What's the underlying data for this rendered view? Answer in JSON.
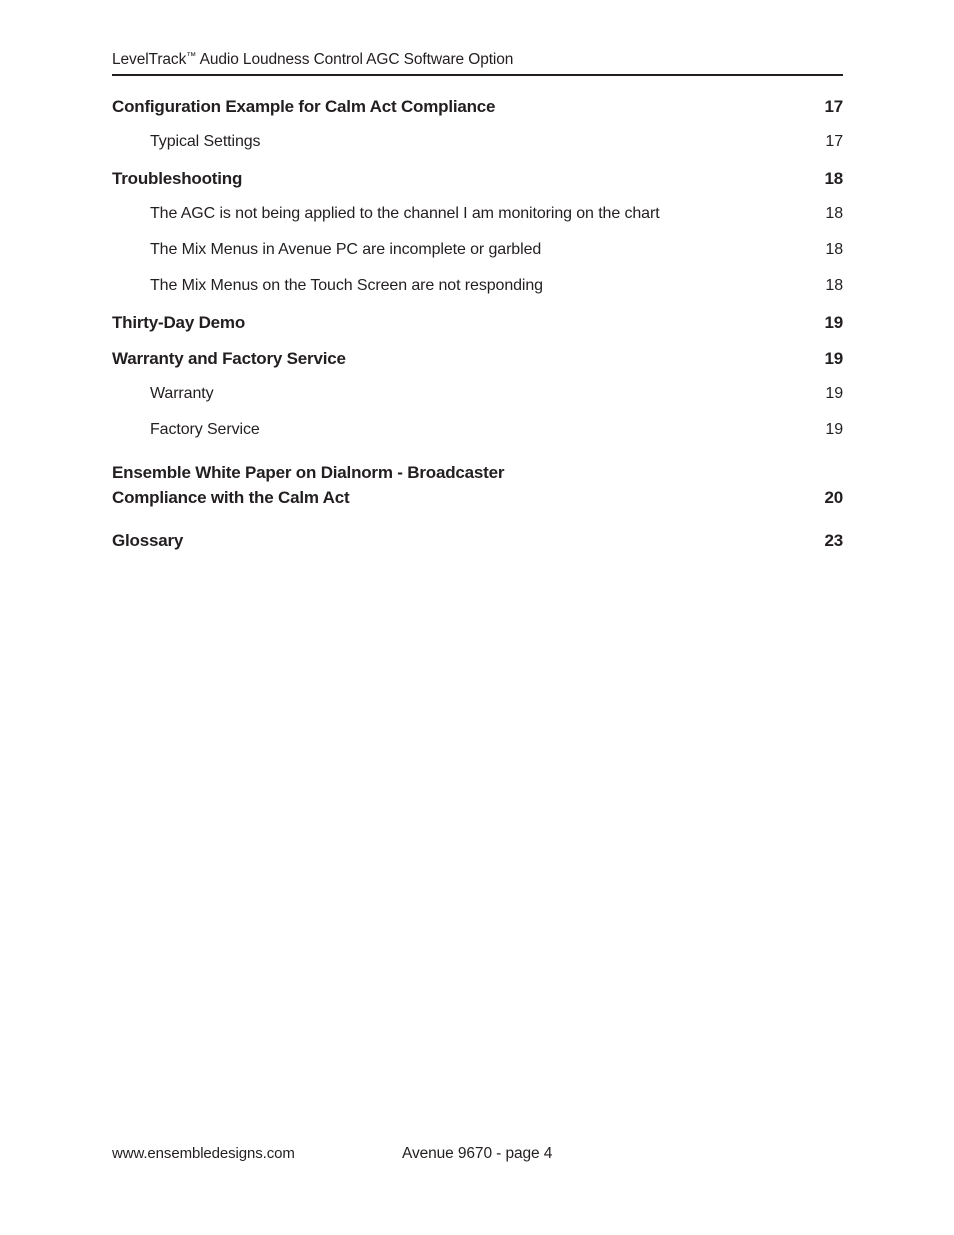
{
  "header": {
    "title_before_tm": "LevelTrack",
    "tm_symbol": "™",
    "title_after_tm": " Audio Loudness Control AGC Software Option"
  },
  "toc": {
    "entries": [
      {
        "level": 1,
        "title": "Configuration Example for Calm Act Compliance",
        "page": "17"
      },
      {
        "level": 2,
        "title": "Typical Settings",
        "page": "17"
      },
      {
        "level": 1,
        "title": "Troubleshooting",
        "page": "18"
      },
      {
        "level": 2,
        "title": "The AGC is not being applied to the channel I am monitoring on the chart",
        "page": "18"
      },
      {
        "level": 2,
        "title": "The Mix Menus in Avenue PC are incomplete or garbled",
        "page": "18"
      },
      {
        "level": 2,
        "title": "The Mix Menus on the Touch Screen are not responding",
        "page": "18"
      },
      {
        "level": 1,
        "title": "Thirty-Day Demo",
        "page": "19"
      },
      {
        "level": 1,
        "title": "Warranty and Factory Service",
        "page": "19"
      },
      {
        "level": 2,
        "title": "Warranty",
        "page": "19"
      },
      {
        "level": 2,
        "title": "Factory Service",
        "page": "19"
      },
      {
        "level": 1,
        "title": "Ensemble White Paper on Dialnorm - Broadcaster\nCompliance with the Calm Act",
        "page": "20"
      },
      {
        "level": 1,
        "title": "Glossary",
        "page": "23"
      }
    ]
  },
  "footer": {
    "website": "www.ensembledesigns.com",
    "page_label": "Avenue 9670 - page 4"
  },
  "colors": {
    "text": "#231f20",
    "rule": "#231f20",
    "background": "#ffffff"
  }
}
